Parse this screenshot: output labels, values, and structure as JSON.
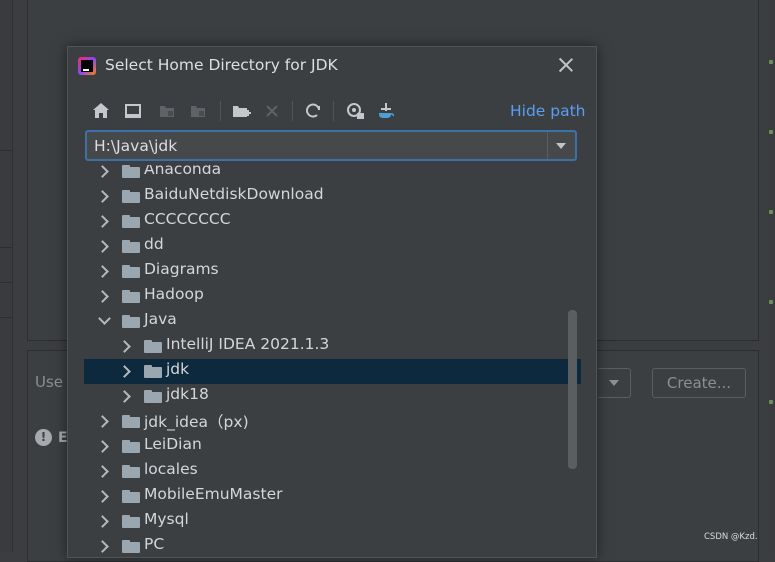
{
  "background": {
    "use_label": "Use",
    "warning_label": "E",
    "create_button": "Create...",
    "watermark": "CSDN @Kzd."
  },
  "dialog": {
    "title": "Select Home Directory for JDK",
    "toolbar": {
      "icons": [
        "home-icon",
        "desktop-icon",
        "project-icon",
        "module-icon",
        "new-folder-icon",
        "delete-icon",
        "refresh-icon",
        "show-hidden-icon",
        "jdk-download-icon"
      ],
      "hide_path_label": "Hide path"
    },
    "path": {
      "value": "H:\\Java\\jdk"
    },
    "tree": [
      {
        "label": "Anaconda",
        "level": 0,
        "expanded": false,
        "selected": false
      },
      {
        "label": "BaiduNetdiskDownload",
        "level": 0,
        "expanded": false,
        "selected": false
      },
      {
        "label": "CCCCCCCC",
        "level": 0,
        "expanded": false,
        "selected": false
      },
      {
        "label": "dd",
        "level": 0,
        "expanded": false,
        "selected": false
      },
      {
        "label": "Diagrams",
        "level": 0,
        "expanded": false,
        "selected": false
      },
      {
        "label": "Hadoop",
        "level": 0,
        "expanded": false,
        "selected": false
      },
      {
        "label": "Java",
        "level": 0,
        "expanded": true,
        "selected": false
      },
      {
        "label": "IntelliJ IDEA 2021.1.3",
        "level": 1,
        "expanded": false,
        "selected": false
      },
      {
        "label": "jdk",
        "level": 1,
        "expanded": false,
        "selected": true
      },
      {
        "label": "jdk18",
        "level": 1,
        "expanded": false,
        "selected": false
      },
      {
        "label": "jdk_idea（px)",
        "level": 0,
        "expanded": false,
        "selected": false
      },
      {
        "label": "LeiDian",
        "level": 0,
        "expanded": false,
        "selected": false
      },
      {
        "label": "locales",
        "level": 0,
        "expanded": false,
        "selected": false
      },
      {
        "label": "MobileEmuMaster",
        "level": 0,
        "expanded": false,
        "selected": false
      },
      {
        "label": "Mysql",
        "level": 0,
        "expanded": false,
        "selected": false
      },
      {
        "label": "PC",
        "level": 0,
        "expanded": false,
        "selected": false
      }
    ]
  },
  "colors": {
    "selection": "#0d293e",
    "link": "#589df6",
    "focus_border": "#3d6fa8",
    "folder": "#9aa7b0"
  }
}
